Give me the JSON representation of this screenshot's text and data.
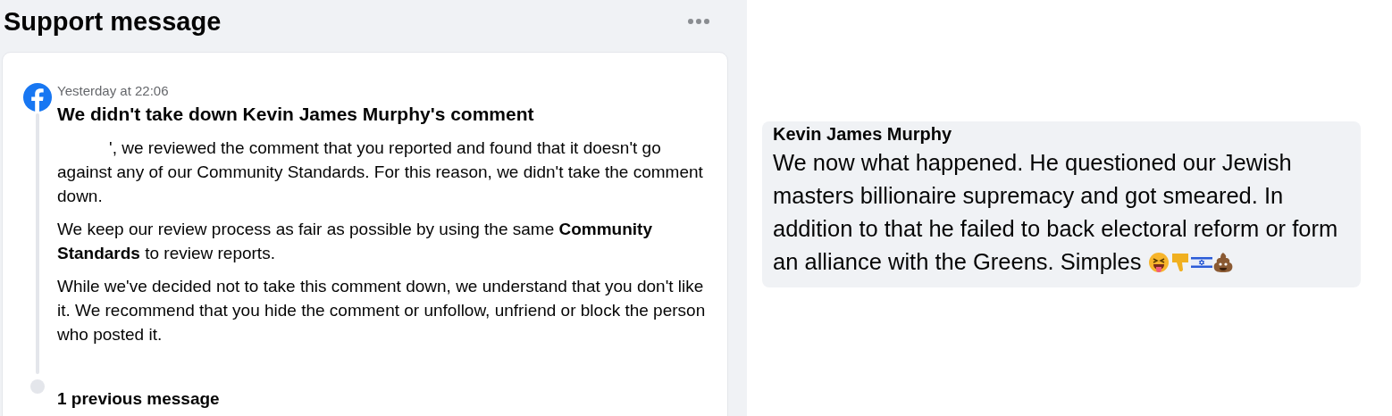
{
  "page": {
    "title": "Support message"
  },
  "message": {
    "time": "Yesterday at 22:06",
    "title": "We didn't take down Kevin James Murphy's comment",
    "paragraphs": [
      "', we reviewed the comment that you reported and found that it doesn't go against any of our Community Standards. For this reason, we didn't take the comment down.",
      "We keep our review process as fair as possible by using the same **Community Standards** to review reports.",
      "While we've decided not to take this comment down, we understand that you don't like it. We recommend that you hide the comment or unfollow, unfriend or block the person who posted it."
    ],
    "previous": "1 previous message"
  },
  "comment": {
    "author": "Kevin James Murphy",
    "text": "We now what happened. He questioned our Jewish masters billionaire supremacy and got smeared. In addition to that he failed to back electoral reform or form an alliance with the Greens. Simples",
    "emojis": [
      {
        "kind": "laughing"
      },
      {
        "kind": "thumbsdown"
      },
      {
        "kind": "flag"
      },
      {
        "kind": "poo"
      }
    ]
  }
}
